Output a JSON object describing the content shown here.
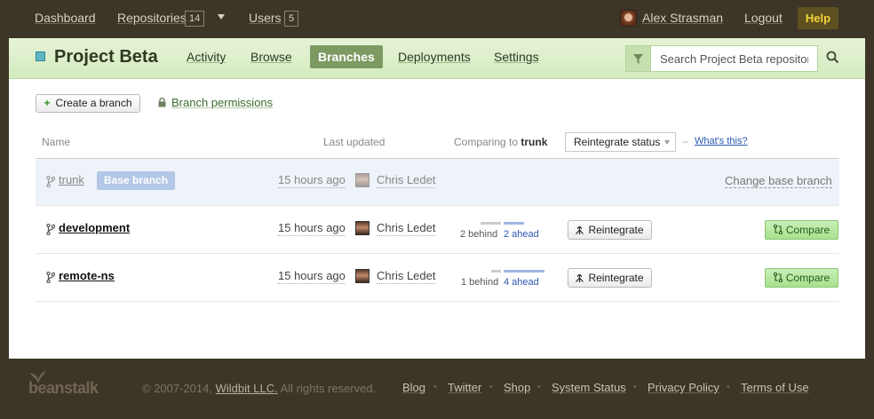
{
  "topbar": {
    "dashboard": "Dashboard",
    "repositories": "Repositories",
    "repositories_count": "14",
    "users": "Users",
    "users_count": "5",
    "user_name": "Alex Strasman",
    "logout": "Logout",
    "help": "Help"
  },
  "project": {
    "title": "Project Beta",
    "tabs": [
      {
        "label": "Activity"
      },
      {
        "label": "Browse"
      },
      {
        "label": "Branches",
        "active": true
      },
      {
        "label": "Deployments"
      },
      {
        "label": "Settings"
      }
    ],
    "search_placeholder": "Search Project Beta repository"
  },
  "actions": {
    "create_branch": "Create a branch",
    "branch_permissions": "Branch permissions"
  },
  "table": {
    "col_name": "Name",
    "col_updated": "Last updated",
    "comparing_prefix": "Comparing to",
    "comparing_branch": "trunk",
    "reintegrate_select": "Reintegrate status",
    "separator": "–",
    "whats_this": "What's this?",
    "rows": [
      {
        "name": "trunk",
        "badge": "Base branch",
        "updated": "15 hours ago",
        "author": "Chris Ledet",
        "change_base": "Change base branch"
      },
      {
        "name": "development",
        "updated": "15 hours ago",
        "author": "Chris Ledet",
        "behind": "2 behind",
        "ahead": "2 ahead",
        "behind_count": 2,
        "ahead_count": 2,
        "reintegrate": "Reintegrate",
        "compare": "Compare"
      },
      {
        "name": "remote-ns",
        "updated": "15 hours ago",
        "author": "Chris Ledet",
        "behind": "1 behind",
        "ahead": "4 ahead",
        "behind_count": 1,
        "ahead_count": 4,
        "reintegrate": "Reintegrate",
        "compare": "Compare"
      }
    ]
  },
  "footer": {
    "logo_text": "beanstalk",
    "copyright_prefix": "© 2007-2014,",
    "company": "Wildbit LLC.",
    "copyright_suffix": "All rights reserved.",
    "links": [
      "Blog",
      "Twitter",
      "Shop",
      "System Status",
      "Privacy Policy",
      "Terms of Use"
    ],
    "separator": "•"
  },
  "colors": {
    "accent_green": "#7d9a62",
    "link_blue": "#2a57b0",
    "help_yellow": "#f1d438",
    "background": "#3d3527"
  }
}
